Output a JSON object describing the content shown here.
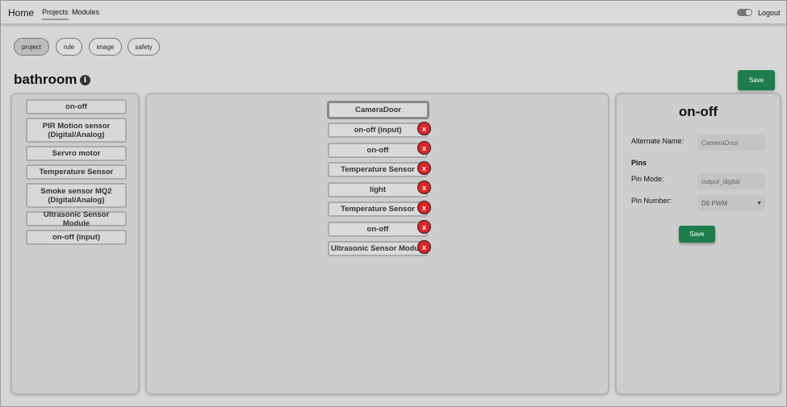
{
  "nav": {
    "home": "Home",
    "projects": "Projects",
    "modules": "Modules",
    "logout": "Logout"
  },
  "tabs": [
    "project",
    "rule",
    "image",
    "safety"
  ],
  "active_tab": "project",
  "page": {
    "title": "bathroom",
    "info_icon": "info-icon",
    "save_label": "Save"
  },
  "module_list": [
    "on-off",
    "PIR Motion sensor (Digital/Analog)",
    "Servro motor",
    "Temperature Sensor",
    "Smoke sensor MQ2 (Digital/Analog)",
    "Ultrasonic Sensor Module",
    "on-off (input)"
  ],
  "canvas": {
    "title": "CameraDoor",
    "remove_label": "x",
    "items": [
      "on-off (input)",
      "on-off",
      "Temperature Sensor",
      "light",
      "Temperature Sensor",
      "on-off",
      "Ultrasonic Sensor Module"
    ]
  },
  "detail": {
    "title": "on-off",
    "alternate_name_label": "Alternate Name:",
    "alternate_name_value": "CameraDoor",
    "pins_heading": "Pins",
    "pin_mode_label": "Pin Mode:",
    "pin_mode_value": "output_digital",
    "pin_number_label": "Pin Number:",
    "pin_number_value": "D6 PWM",
    "save_label": "Save"
  },
  "colors": {
    "accent_green": "#1e7d4c",
    "remove_red": "#e02424",
    "background": "#d6d6d6"
  }
}
